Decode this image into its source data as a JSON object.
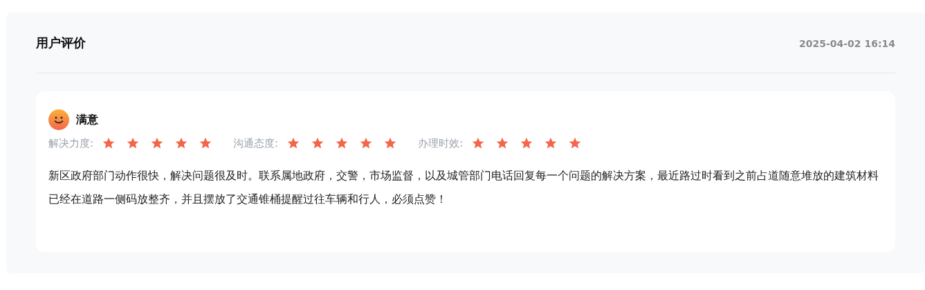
{
  "title": "用户评价",
  "date": "2025-04-02 16:14",
  "review": {
    "mood": "满意",
    "ratings": [
      {
        "label": "解决力度:",
        "stars": 5
      },
      {
        "label": "沟通态度:",
        "stars": 5
      },
      {
        "label": "办理时效:",
        "stars": 5
      }
    ],
    "text": "新区政府部门动作很快，解决问题很及时。联系属地政府，交警，市场监督，以及城管部门电话回复每一个问题的解决方案，最近路过时看到之前占道随意堆放的建筑材料已经在道路一侧码放整齐，并且摆放了交通锥桶提醒过往车辆和行人，必须点赞！"
  }
}
